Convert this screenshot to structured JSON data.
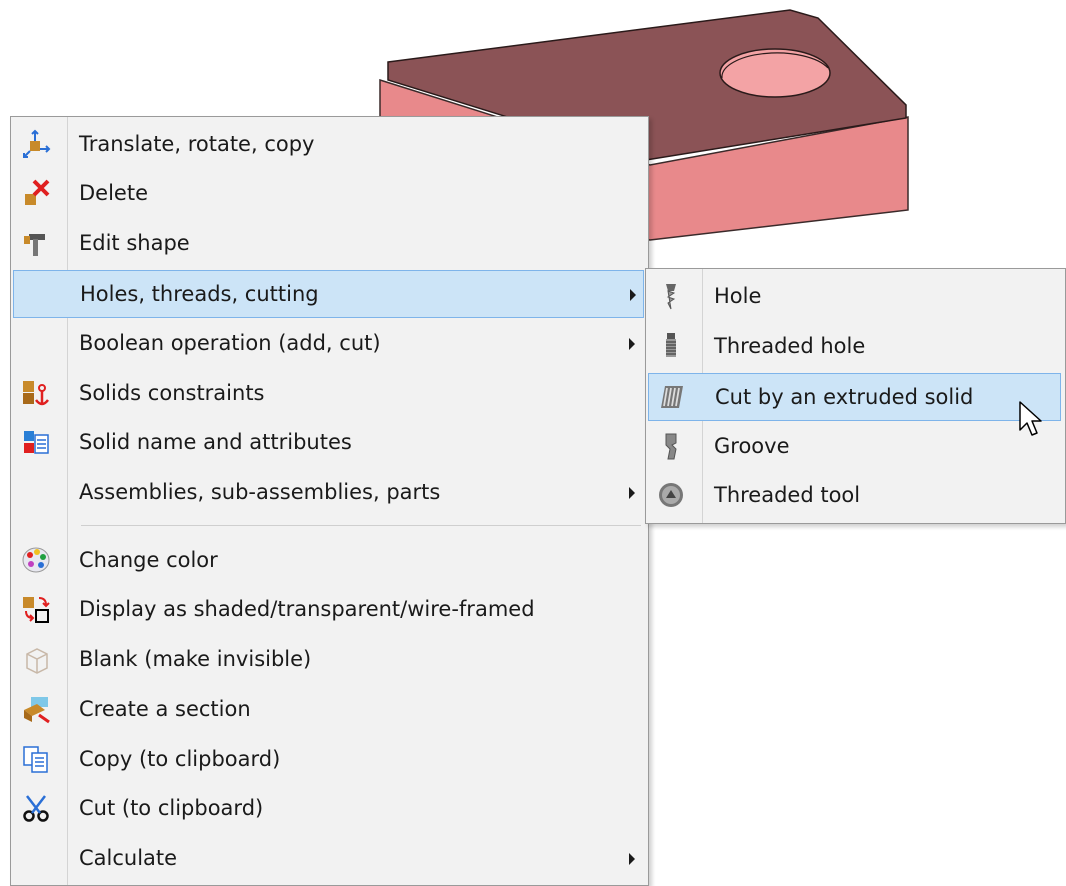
{
  "context_menu": {
    "items": [
      {
        "label": "Translate, rotate, copy",
        "icon": "move-arrows-icon",
        "submenu": false
      },
      {
        "label": "Delete",
        "icon": "delete-x-icon",
        "submenu": false
      },
      {
        "label": "Edit shape",
        "icon": "edit-hammer-icon",
        "submenu": false
      },
      {
        "label": "Holes, threads, cutting",
        "icon": "",
        "submenu": true,
        "highlighted": true
      },
      {
        "label": "Boolean operation (add, cut)",
        "icon": "",
        "submenu": true
      },
      {
        "label": "Solids constraints",
        "icon": "anchor-icon",
        "submenu": false
      },
      {
        "label": "Solid name and attributes",
        "icon": "attributes-icon",
        "submenu": false
      },
      {
        "label": "Assemblies, sub-assemblies, parts",
        "icon": "",
        "submenu": true
      },
      {
        "label": "Change color",
        "icon": "palette-icon",
        "submenu": false
      },
      {
        "label": "Display as shaded/transparent/wire-framed",
        "icon": "display-mode-icon",
        "submenu": false
      },
      {
        "label": "Blank (make invisible)",
        "icon": "blank-cube-icon",
        "submenu": false
      },
      {
        "label": "Create a section",
        "icon": "section-icon",
        "submenu": false
      },
      {
        "label": "Copy (to clipboard)",
        "icon": "copy-icon",
        "submenu": false
      },
      {
        "label": "Cut (to clipboard)",
        "icon": "scissors-icon",
        "submenu": false
      },
      {
        "label": "Calculate",
        "icon": "",
        "submenu": true
      }
    ]
  },
  "submenu": {
    "items": [
      {
        "label": "Hole",
        "icon": "drill-icon"
      },
      {
        "label": "Threaded hole",
        "icon": "tap-icon"
      },
      {
        "label": "Cut by an extruded solid",
        "icon": "extrude-cut-icon",
        "highlighted": true
      },
      {
        "label": "Groove",
        "icon": "groove-tool-icon"
      },
      {
        "label": "Threaded tool",
        "icon": "thread-tool-icon"
      }
    ]
  },
  "colors": {
    "highlight": "#cce4f7",
    "highlight_border": "#7eb4ea",
    "menu_bg": "#f2f2f2",
    "solid_top": "#8b5356",
    "solid_side": "#e8898b"
  }
}
